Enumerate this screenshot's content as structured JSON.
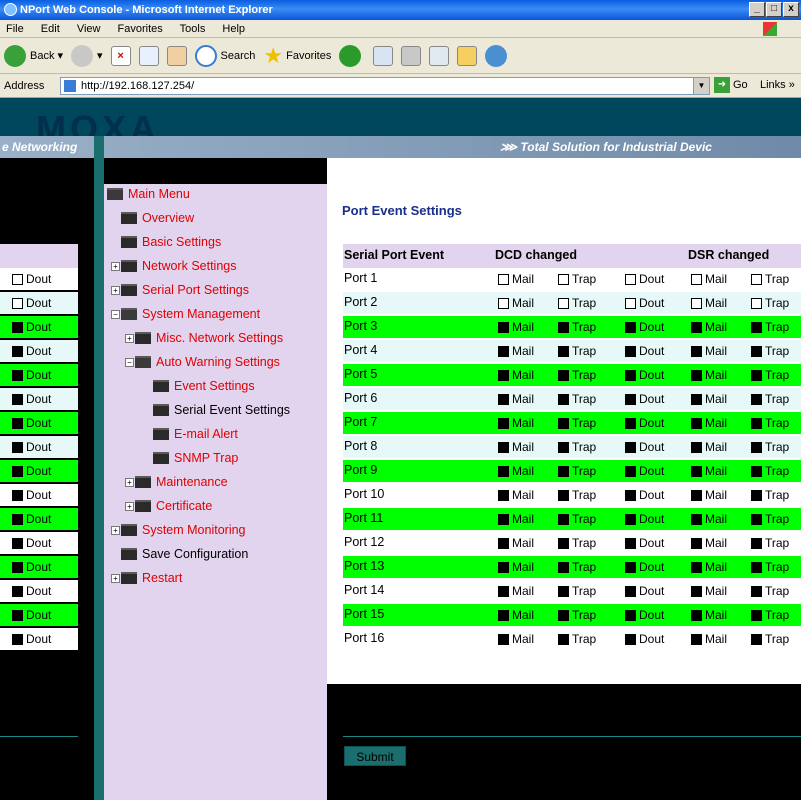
{
  "window": {
    "title": "NPort Web Console - Microsoft Internet Explorer",
    "controls": [
      "_",
      "□",
      "x"
    ]
  },
  "menubar": {
    "items": [
      "File",
      "Edit",
      "View",
      "Favorites",
      "Tools",
      "Help"
    ]
  },
  "toolbar": {
    "back": "Back",
    "search": "Search",
    "favorites": "Favorites"
  },
  "address": {
    "label": "Address",
    "url": "http://192.168.127.254/",
    "go": "Go",
    "links": "Links"
  },
  "banner": {
    "logo": "MOXA",
    "left_tag": "e Networking",
    "right_tag": "Total Solution for Industrial Devic"
  },
  "nav": {
    "items": [
      {
        "label": "Main Menu",
        "icon": "folder-open-icon"
      },
      {
        "label": "Overview",
        "icon": "folder-icon"
      },
      {
        "label": "Basic Settings",
        "icon": "folder-icon"
      },
      {
        "label": "Network Settings",
        "icon": "folder-icon"
      },
      {
        "label": "Serial Port Settings",
        "icon": "folder-icon"
      },
      {
        "label": "System Management",
        "icon": "folder-open-icon"
      },
      {
        "label": "Misc. Network Settings",
        "icon": "folder-icon"
      },
      {
        "label": "Auto Warning Settings",
        "icon": "folder-open-icon"
      },
      {
        "label": "Event Settings",
        "icon": "folder-icon"
      },
      {
        "label": "Serial Event Settings",
        "icon": "folder-icon"
      },
      {
        "label": "E-mail Alert",
        "icon": "folder-icon"
      },
      {
        "label": "SNMP Trap",
        "icon": "folder-icon"
      },
      {
        "label": "Maintenance",
        "icon": "folder-icon"
      },
      {
        "label": "Certificate",
        "icon": "folder-icon"
      },
      {
        "label": "System Monitoring",
        "icon": "folder-icon"
      },
      {
        "label": "Save Configuration",
        "icon": "folder-icon"
      },
      {
        "label": "Restart",
        "icon": "folder-icon"
      }
    ]
  },
  "main": {
    "title": "Port Event Settings",
    "headers": {
      "col1": "Serial Port Event",
      "col2": "DCD changed",
      "col3": "DSR changed"
    },
    "options": {
      "mail": "Mail",
      "trap": "Trap",
      "dout": "Dout"
    },
    "rows": [
      {
        "port": "Port 1",
        "checked": false,
        "bg": "#ffffff"
      },
      {
        "port": "Port 2",
        "checked": false,
        "bg": "#e6f8f8"
      },
      {
        "port": "Port 3",
        "checked": true,
        "bg": "#00ff00"
      },
      {
        "port": "Port 4",
        "checked": true,
        "bg": "#e6f8f8"
      },
      {
        "port": "Port 5",
        "checked": true,
        "bg": "#00ff00"
      },
      {
        "port": "Port 6",
        "checked": true,
        "bg": "#e6f8f8"
      },
      {
        "port": "Port 7",
        "checked": true,
        "bg": "#00ff00"
      },
      {
        "port": "Port 8",
        "checked": true,
        "bg": "#e6f8f8"
      },
      {
        "port": "Port 9",
        "checked": true,
        "bg": "#00ff00"
      },
      {
        "port": "Port 10",
        "checked": true,
        "bg": "#ffffff"
      },
      {
        "port": "Port 11",
        "checked": true,
        "bg": "#00ff00"
      },
      {
        "port": "Port 12",
        "checked": true,
        "bg": "#ffffff"
      },
      {
        "port": "Port 13",
        "checked": true,
        "bg": "#00ff00"
      },
      {
        "port": "Port 14",
        "checked": true,
        "bg": "#ffffff"
      },
      {
        "port": "Port 15",
        "checked": true,
        "bg": "#00ff00"
      },
      {
        "port": "Port 16",
        "checked": true,
        "bg": "#ffffff"
      }
    ],
    "submit": "Submit"
  },
  "colors": {
    "menu_bg": "#e2d4ee",
    "menu_text": "#e00000",
    "title_text": "#1a2e8a",
    "teal": "#1a6e6e"
  }
}
